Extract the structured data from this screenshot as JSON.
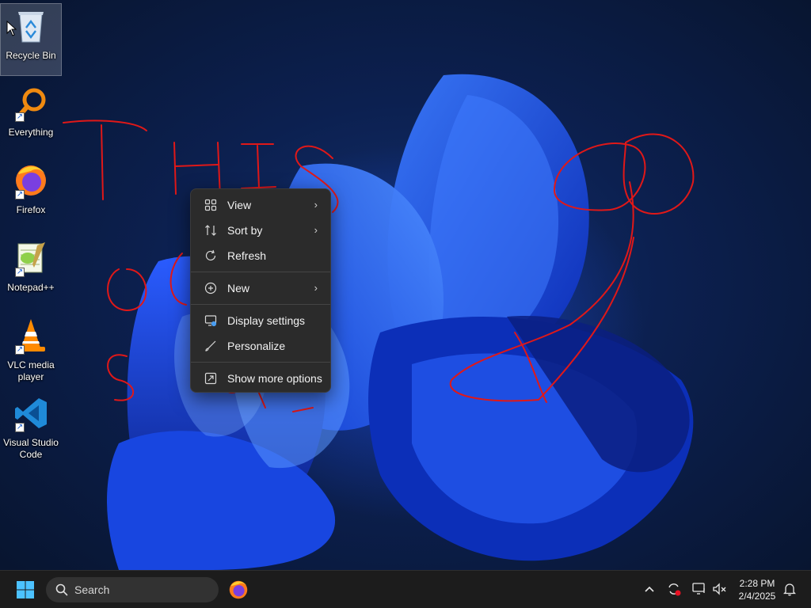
{
  "desktop": {
    "icons": [
      {
        "label": "Recycle Bin"
      },
      {
        "label": "Everything"
      },
      {
        "label": "Firefox"
      },
      {
        "label": "Notepad++"
      },
      {
        "label": "VLC media player"
      },
      {
        "label": "Visual Studio Code"
      }
    ]
  },
  "context_menu": {
    "items": [
      {
        "label": "View",
        "icon": "grid-icon",
        "submenu": true
      },
      {
        "label": "Sort by",
        "icon": "sort-icon",
        "submenu": true
      },
      {
        "label": "Refresh",
        "icon": "refresh-icon",
        "submenu": false
      },
      {
        "label": "New",
        "icon": "plus-circle-icon",
        "submenu": true
      },
      {
        "label": "Display settings",
        "icon": "display-icon",
        "submenu": false
      },
      {
        "label": "Personalize",
        "icon": "brush-icon",
        "submenu": false
      },
      {
        "label": "Show more options",
        "icon": "expand-icon",
        "submenu": false
      }
    ]
  },
  "taskbar": {
    "search_placeholder": "Search",
    "clock": {
      "time": "2:28 PM",
      "date": "2/4/2025"
    }
  },
  "colors": {
    "menu_bg": "#2b2b2b",
    "taskbar_bg": "#1c1c1c",
    "scribble": "#e01818",
    "wallpaper_accent": "#1e50ff"
  }
}
